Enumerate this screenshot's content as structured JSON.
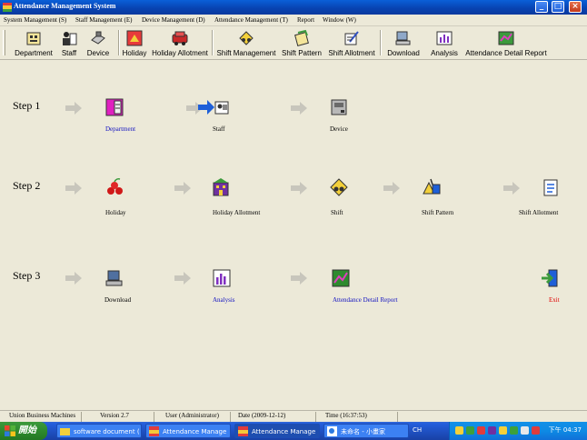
{
  "window": {
    "title": "Attendance Management System",
    "buttons": {
      "minimize": "_",
      "maximize": "□",
      "close": "×"
    }
  },
  "menu": [
    "System Management (S)",
    "Staff Management (E)",
    "Device Management (D)",
    "Attendance Management (T)",
    "Report",
    "Window (W)"
  ],
  "toolbar": [
    {
      "label": "Department",
      "icon": "department-icon"
    },
    {
      "label": "Staff",
      "icon": "staff-icon"
    },
    {
      "label": "Device",
      "icon": "device-icon"
    },
    {
      "label": "Holiday",
      "icon": "holiday-icon"
    },
    {
      "label": "Holiday Allotment",
      "icon": "holiday-allotment-icon"
    },
    {
      "label": "Shift Management",
      "icon": "shift-management-icon"
    },
    {
      "label": "Shift Pattern",
      "icon": "shift-pattern-icon"
    },
    {
      "label": "Shift Allotment",
      "icon": "shift-allotment-icon"
    },
    {
      "label": "Download",
      "icon": "download-icon"
    },
    {
      "label": "Analysis",
      "icon": "analysis-icon"
    },
    {
      "label": "Attendance Detail Report",
      "icon": "attendance-report-icon"
    }
  ],
  "steps": {
    "step1": {
      "label": "Step 1",
      "items": [
        "Department",
        "Staff",
        "Device"
      ]
    },
    "step2": {
      "label": "Step 2",
      "items": [
        "Holiday",
        "Holiday Allotment",
        "Shift",
        "Shift Pattern",
        "Shift Allotment"
      ]
    },
    "step3": {
      "label": "Step 3",
      "items": [
        "Download",
        "Analysis",
        "Attendance Detail Report",
        "Exit"
      ]
    }
  },
  "status": {
    "company": "Union Business Machines",
    "version": "Version 2.7",
    "user": "User (Administrator)",
    "date": "Date (2009-12-12)",
    "time": "Time (16:37:53)"
  },
  "taskbar": {
    "start": "開始",
    "tasks": [
      "software document (",
      "Attendance Manage",
      "Attendance Manage",
      "未命名 - 小畫家"
    ],
    "ime": "CH",
    "clock": "下午 04:37"
  },
  "colors": {
    "accent": "#0A5FD8",
    "link": "#1010C0",
    "exit": "#E00000",
    "background": "#ECE9D8"
  }
}
